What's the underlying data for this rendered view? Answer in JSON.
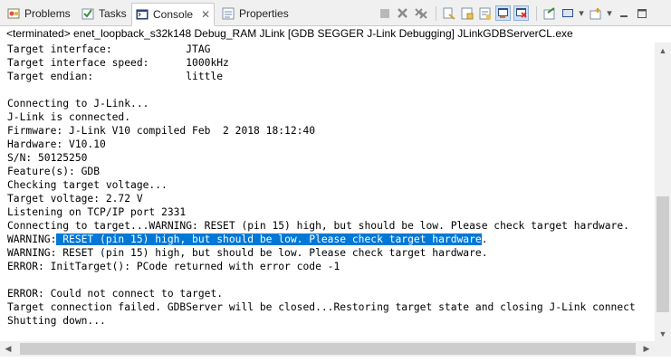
{
  "tabs": [
    {
      "label": "Problems",
      "icon": "problems-icon"
    },
    {
      "label": "Tasks",
      "icon": "tasks-icon"
    },
    {
      "label": "Console",
      "icon": "console-icon",
      "active": true
    },
    {
      "label": "Properties",
      "icon": "properties-icon"
    }
  ],
  "toolbar": {
    "icons": [
      "terminate-icon",
      "remove-launch-icon",
      "remove-all-terminated-icon",
      "clear-console-icon",
      "scroll-lock-icon",
      "word-wrap-icon",
      "show-on-stdout-icon",
      "show-on-stderr-icon",
      "pin-console-icon",
      "display-console-icon",
      "open-console-icon",
      "minimize-icon",
      "maximize-icon"
    ]
  },
  "console": {
    "title": "<terminated> enet_loopback_s32k148 Debug_RAM JLink [GDB SEGGER J-Link Debugging] JLinkGDBServerCL.exe",
    "lines": [
      "Target interface:            JTAG",
      "Target interface speed:      1000kHz",
      "Target endian:               little",
      "",
      "Connecting to J-Link...",
      "J-Link is connected.",
      "Firmware: J-Link V10 compiled Feb  2 2018 18:12:40",
      "Hardware: V10.10",
      "S/N: 50125250",
      "Feature(s): GDB",
      "Checking target voltage...",
      "Target voltage: 2.72 V",
      "Listening on TCP/IP port 2331",
      "Connecting to target...WARNING: RESET (pin 15) high, but should be low. Please check target hardware.",
      "",
      "WARNING: RESET (pin 15) high, but should be low. Please check target hardware.",
      "ERROR: InitTarget(): PCode returned with error code -1",
      "",
      "ERROR: Could not connect to target.",
      "Target connection failed. GDBServer will be closed...Restoring target state and closing J-Link connect",
      "Shutting down..."
    ],
    "selected_line": {
      "prefix": "WARNING:",
      "selected": " RESET (pin 15) high, but should be low. Please check target hardware",
      "suffix": "."
    }
  }
}
